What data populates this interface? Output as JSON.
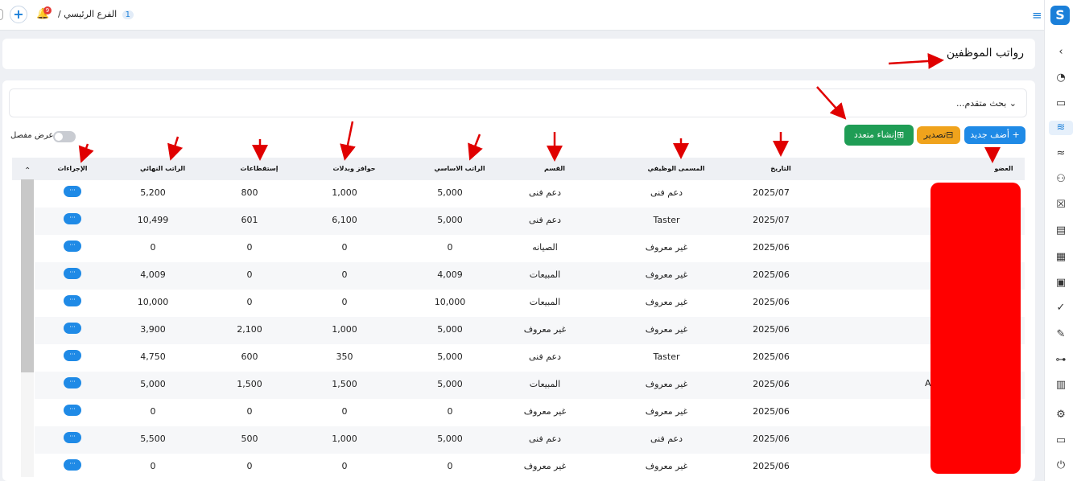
{
  "header": {
    "branch_label": "الفرع الرئيسي /",
    "branch_num": "1",
    "notification_count": "9",
    "add_icon": "plus-icon",
    "bell_icon": "bell-icon",
    "menu_icon": "hamburger-icon"
  },
  "page": {
    "title": "رواتب الموظفين"
  },
  "search": {
    "label": "بحث متقدم...",
    "icon": "chevron-down-icon"
  },
  "actions": {
    "add_new": "أضف جديد",
    "export": "تصدير",
    "bulk_create": "إنشاء متعدد"
  },
  "view_toggle": {
    "label": "عرض مفصل"
  },
  "table": {
    "columns": {
      "member": "العضو",
      "date": "التاريخ",
      "job_title": "المسمى الوظيفي",
      "department": "القسم",
      "base_salary": "الراتب الاساسي",
      "allowances": "حوافز وبدلات",
      "deductions": "إستقطاعات",
      "final_salary": "الراتب النهائي",
      "actions": "الإجراءات"
    },
    "action_label": "···",
    "rows": [
      {
        "date": "2025/07",
        "job_title": "دعم فنى",
        "department": "دعم فنى",
        "base_salary": "5,000",
        "allowances": "1,000",
        "deductions": "800",
        "final_salary": "5,200"
      },
      {
        "date": "2025/07",
        "job_title": "Taster",
        "department": "دعم فنى",
        "base_salary": "5,000",
        "allowances": "6,100",
        "deductions": "601",
        "final_salary": "10,499"
      },
      {
        "date": "2025/06",
        "job_title": "غير معروف",
        "department": "الصيانه",
        "base_salary": "0",
        "allowances": "0",
        "deductions": "0",
        "final_salary": "0"
      },
      {
        "date": "2025/06",
        "job_title": "غير معروف",
        "department": "المبيعات",
        "base_salary": "4,009",
        "allowances": "0",
        "deductions": "0",
        "final_salary": "4,009"
      },
      {
        "date": "2025/06",
        "job_title": "غير معروف",
        "department": "المبيعات",
        "base_salary": "10,000",
        "allowances": "0",
        "deductions": "0",
        "final_salary": "10,000"
      },
      {
        "date": "2025/06",
        "job_title": "غير معروف",
        "department": "غير معروف",
        "base_salary": "5,000",
        "allowances": "1,000",
        "deductions": "2,100",
        "final_salary": "3,900"
      },
      {
        "date": "2025/06",
        "job_title": "Taster",
        "department": "دعم فنى",
        "base_salary": "5,000",
        "allowances": "350",
        "deductions": "600",
        "final_salary": "4,750"
      },
      {
        "date": "2025/06",
        "job_title": "غير معروف",
        "department": "المبيعات",
        "base_salary": "5,000",
        "allowances": "1,500",
        "deductions": "1,500",
        "final_salary": "5,000"
      },
      {
        "date": "2025/06",
        "job_title": "غير معروف",
        "department": "غير معروف",
        "base_salary": "0",
        "allowances": "0",
        "deductions": "0",
        "final_salary": "0"
      },
      {
        "date": "2025/06",
        "job_title": "دعم فنى",
        "department": "دعم فنى",
        "base_salary": "5,000",
        "allowances": "1,000",
        "deductions": "500",
        "final_salary": "5,500"
      },
      {
        "date": "2025/06",
        "job_title": "غير معروف",
        "department": "غير معروف",
        "base_salary": "0",
        "allowances": "0",
        "deductions": "0",
        "final_salary": "0"
      }
    ],
    "stray_text": "A"
  },
  "sidebar": {
    "logo": "S",
    "items": [
      {
        "icon": "chevron-left-icon",
        "glyph": "‹"
      },
      {
        "icon": "dashboard-icon",
        "glyph": "◔"
      },
      {
        "icon": "ticket-icon",
        "glyph": "▭"
      },
      {
        "icon": "salary-icon",
        "glyph": "≋"
      },
      {
        "icon": "payroll-icon",
        "glyph": "≈"
      },
      {
        "icon": "users-settings-icon",
        "glyph": "⚇"
      },
      {
        "icon": "calendar-x-icon",
        "glyph": "☒"
      },
      {
        "icon": "document-icon",
        "glyph": "▤"
      },
      {
        "icon": "apps-icon",
        "glyph": "▦"
      },
      {
        "icon": "vehicle-icon",
        "glyph": "▣"
      },
      {
        "icon": "check-badge-icon",
        "glyph": "✓"
      },
      {
        "icon": "signature-icon",
        "glyph": "✎"
      },
      {
        "icon": "hierarchy-icon",
        "glyph": "⊶"
      },
      {
        "icon": "chart-icon",
        "glyph": "▥"
      },
      {
        "icon": "settings-icon",
        "glyph": "⚙"
      },
      {
        "icon": "window-icon",
        "glyph": "▭"
      },
      {
        "icon": "power-icon",
        "glyph": "⏻"
      }
    ]
  },
  "colors": {
    "primary": "#1f8ae6",
    "export": "#f0a31c",
    "bulk": "#1f9d55",
    "redaction": "#ff0000",
    "annotation_arrow": "#e00000"
  }
}
